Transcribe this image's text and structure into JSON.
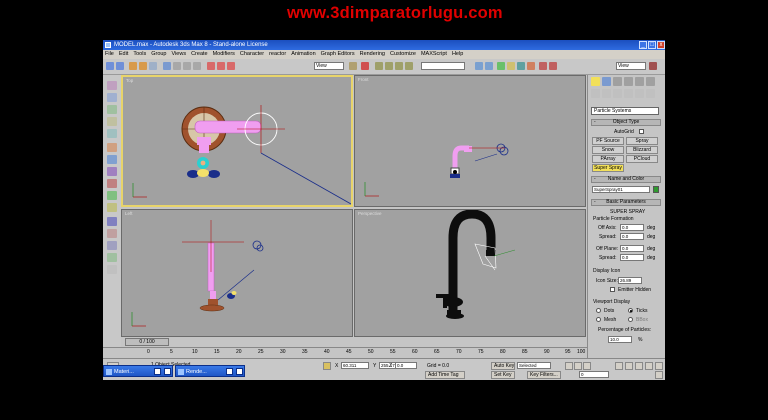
{
  "window": {
    "title": "MODEL.max - Autodesk 3ds Max 8   - Stand-alone License",
    "minimize_label": "_",
    "maximize_label": "□",
    "close_label": "x"
  },
  "watermark": "www.3dimparatorlugu.com",
  "menu": [
    "File",
    "Edit",
    "Tools",
    "Group",
    "Views",
    "Create",
    "Modifiers",
    "Character",
    "reactor",
    "Animation",
    "Graph Editors",
    "Rendering",
    "Customize",
    "MAXScript",
    "Help"
  ],
  "toolbar": {
    "view_dropdown_left": "View",
    "view_dropdown_right": "View"
  },
  "viewports": {
    "top": "Top",
    "front": "Front",
    "left": "Left",
    "perspective": "Perspective"
  },
  "command_panel": {
    "category": "Particle Systems",
    "object_type_header": "Object Type",
    "autogrid_label": "AutoGrid",
    "buttons": [
      "PF Source",
      "Spray",
      "Snow",
      "Blizzard",
      "PArray",
      "PCloud",
      "Super Spray"
    ],
    "name_color_header": "Name and Color",
    "object_name": "SuperSpray01",
    "basic_params_header": "Basic Parameters",
    "section_title": "SUPER SPRAY",
    "particle_formation": "Particle Formation",
    "off_axis_label": "Off Axis:",
    "off_axis_value": "0.0",
    "spread1_label": "Spread:",
    "spread1_value": "0.0",
    "off_plane_label": "Off Plane:",
    "off_plane_value": "0.0",
    "spread2_label": "Spread:",
    "spread2_value": "0.0",
    "deg": "deg",
    "display_icon": "Display Icon",
    "icon_size_label": "Icon Size:",
    "icon_size_value": "26.89",
    "emitter_hidden": "Emitter Hidden",
    "viewport_display": "Viewport Display",
    "dots": "Dots",
    "ticks": "Ticks",
    "mesh": "Mesh",
    "bbox": "BBox",
    "percentage_label": "Percentage of Particles:",
    "percentage_value": "10.0",
    "percent_sign": "%"
  },
  "timeline": {
    "slider": "0 / 100",
    "ticks": [
      "0",
      "5",
      "10",
      "15",
      "20",
      "25",
      "30",
      "35",
      "40",
      "45",
      "50",
      "55",
      "60",
      "65",
      "70",
      "75",
      "80",
      "85",
      "90",
      "95",
      "100"
    ]
  },
  "status": {
    "selected_text": "1 Object Selected",
    "x_label": "X",
    "x_value": "60.311",
    "y_label": "Y",
    "y_value": "255.175",
    "z_label": "Z",
    "z_value": "0.0",
    "grid": "Grid = 0.0",
    "add_time_tag": "Add Time Tag",
    "auto_key": "Auto Key",
    "selected_dropdown": "Selected",
    "set_key": "Set Key",
    "key_filters": "Key Filters...",
    "frame_value": "0"
  },
  "taskbar": [
    {
      "label": "Materi..."
    },
    {
      "label": "Rende..."
    }
  ],
  "colors": {
    "title_blue": "#2f6be0",
    "watermark_red": "#e00000",
    "viewport_bg": "#a1a1a1",
    "active_border": "#e8d46a",
    "selection_pink": "#f09ef0"
  }
}
